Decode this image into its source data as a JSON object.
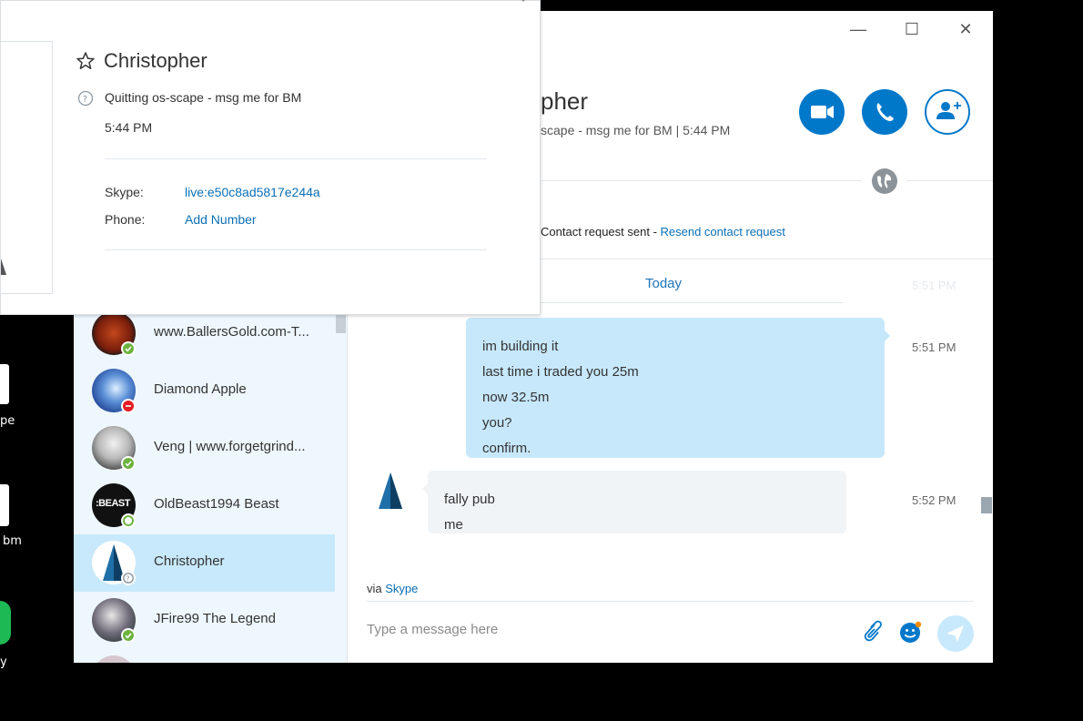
{
  "desktop": {
    "labels": [
      "pe",
      "bm",
      "y"
    ]
  },
  "window": {
    "controls": {
      "minimize": "—",
      "maximize": "☐",
      "close": "✕"
    }
  },
  "contacts": [
    {
      "name": "www.BallersGold.com-T...",
      "status": "online"
    },
    {
      "name": "Diamond Apple",
      "status": "dnd"
    },
    {
      "name": "Veng | www.forgetgrind...",
      "status": "online"
    },
    {
      "name": "OldBeast1994 Beast",
      "status": "offline"
    },
    {
      "name": "Christopher",
      "status": "unknown",
      "selected": true
    },
    {
      "name": "JFire99 The Legend",
      "status": "online"
    }
  ],
  "conversation": {
    "header": {
      "name_partial": "pher",
      "subtitle_partial": "scape - msg me for BM  |  5:44 PM"
    },
    "request": {
      "text": "Contact request sent - ",
      "link": "Resend contact request"
    },
    "day_divider": "Today",
    "ghost_time": "5:51 PM",
    "outgoing": {
      "lines": [
        "im building it",
        "last time i traded you 25m",
        "now 32.5m",
        "you?",
        "confirm."
      ],
      "time": "5:51 PM"
    },
    "incoming": {
      "lines": [
        "fally pub",
        "me"
      ],
      "time": "5:52 PM"
    },
    "via_prefix": "via ",
    "via_link": "Skype",
    "compose_placeholder": "Type a message here"
  },
  "profile_popup": {
    "name": "Christopher",
    "mood": "Quitting os-scape - msg me for BM",
    "time": "5:44 PM",
    "skype_label": "Skype:",
    "skype_value": "live:e50c8ad5817e244a",
    "phone_label": "Phone:",
    "phone_value": "Add Number"
  },
  "colors": {
    "accent": "#0078ca",
    "outgoing_bubble": "#c7e8fb",
    "incoming_bubble": "#f0f4f7",
    "sidebar_bg": "#eef7fd",
    "selected_row": "#c8e9fb",
    "online": "#6cb33e",
    "dnd": "#e51b24"
  }
}
